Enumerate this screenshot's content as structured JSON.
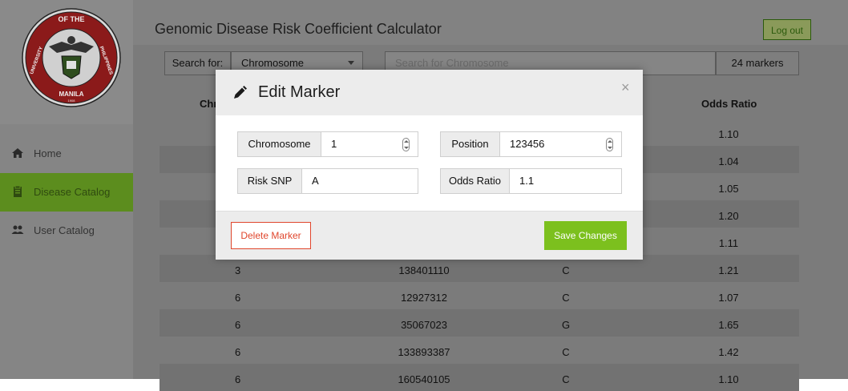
{
  "app": {
    "title": "Genomic Disease Risk Coefficient Calculator",
    "logout_label": "Log out"
  },
  "sidebar": {
    "logo_text_top": "OF THE",
    "logo_text_left": "UNIVERSITY",
    "logo_text_right": "PHILIPPINES",
    "logo_text_bottom": "MANILA",
    "logo_year": "1908",
    "items": [
      {
        "label": "Home",
        "icon": "home-icon"
      },
      {
        "label": "Disease Catalog",
        "icon": "clipboard-icon"
      },
      {
        "label": "User Catalog",
        "icon": "users-icon"
      }
    ]
  },
  "search": {
    "label": "Search for:",
    "selected": "Chromosome",
    "placeholder": "Search for Chromosome",
    "count": "24 markers"
  },
  "table": {
    "headers": [
      "Chr",
      "Odds Ratio"
    ],
    "rows": [
      {
        "chromosome": "",
        "position": "",
        "risk_snp": "",
        "odds_ratio": "1.10"
      },
      {
        "chromosome": "",
        "position": "",
        "risk_snp": "",
        "odds_ratio": "1.04"
      },
      {
        "chromosome": "",
        "position": "",
        "risk_snp": "",
        "odds_ratio": "1.05"
      },
      {
        "chromosome": "",
        "position": "",
        "risk_snp": "",
        "odds_ratio": "1.20"
      },
      {
        "chromosome": "",
        "position": "",
        "risk_snp": "",
        "odds_ratio": "1.11"
      },
      {
        "chromosome": "3",
        "position": "138401110",
        "risk_snp": "C",
        "odds_ratio": "1.21"
      },
      {
        "chromosome": "6",
        "position": "12927312",
        "risk_snp": "C",
        "odds_ratio": "1.07"
      },
      {
        "chromosome": "6",
        "position": "35067023",
        "risk_snp": "G",
        "odds_ratio": "1.65"
      },
      {
        "chromosome": "6",
        "position": "133893387",
        "risk_snp": "C",
        "odds_ratio": "1.42"
      },
      {
        "chromosome": "6",
        "position": "160540105",
        "risk_snp": "C",
        "odds_ratio": "1.10"
      }
    ]
  },
  "modal": {
    "title": "Edit Marker",
    "close_glyph": "×",
    "fields": {
      "chromosome": {
        "label": "Chromosome",
        "value": "1"
      },
      "position": {
        "label": "Position",
        "value": "123456"
      },
      "risk_snp": {
        "label": "Risk SNP",
        "value": "A"
      },
      "odds_ratio": {
        "label": "Odds Ratio",
        "value": "1.1"
      }
    },
    "delete_label": "Delete Marker",
    "save_label": "Save Changes"
  },
  "colors": {
    "accent_green": "#7cc01e",
    "sidebar_active": "#5c8d1e",
    "danger": "#e0462c",
    "logo_red": "#8b1a1a"
  }
}
